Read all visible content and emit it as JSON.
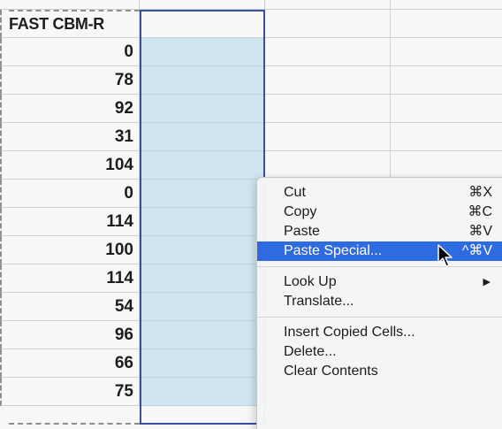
{
  "spreadsheet": {
    "header_label": "FAST CBM-R",
    "values": [
      "0",
      "78",
      "92",
      "31",
      "104",
      "0",
      "114",
      "100",
      "114",
      "54",
      "96",
      "66",
      "75"
    ]
  },
  "context_menu": {
    "items": [
      {
        "id": "cut",
        "label": "Cut",
        "shortcut": "⌘X"
      },
      {
        "id": "copy",
        "label": "Copy",
        "shortcut": "⌘C"
      },
      {
        "id": "paste",
        "label": "Paste",
        "shortcut": "⌘V"
      },
      {
        "id": "paste-special",
        "label": "Paste Special...",
        "shortcut": "^⌘V",
        "highlighted": true
      },
      {
        "separator": true
      },
      {
        "id": "look-up",
        "label": "Look Up",
        "submenu": true
      },
      {
        "id": "translate",
        "label": "Translate..."
      },
      {
        "separator": true
      },
      {
        "id": "insert-copied-cells",
        "label": "Insert Copied Cells..."
      },
      {
        "id": "delete",
        "label": "Delete..."
      },
      {
        "id": "clear-contents",
        "label": "Clear Contents"
      }
    ]
  },
  "colors": {
    "selection_fill": "#cfe6f1",
    "selection_border": "#3a4f9e",
    "menu_highlight": "#2e6ae0"
  },
  "icons": {
    "cursor": "arrow-pointer-icon",
    "submenu": "triangle-right-icon"
  }
}
